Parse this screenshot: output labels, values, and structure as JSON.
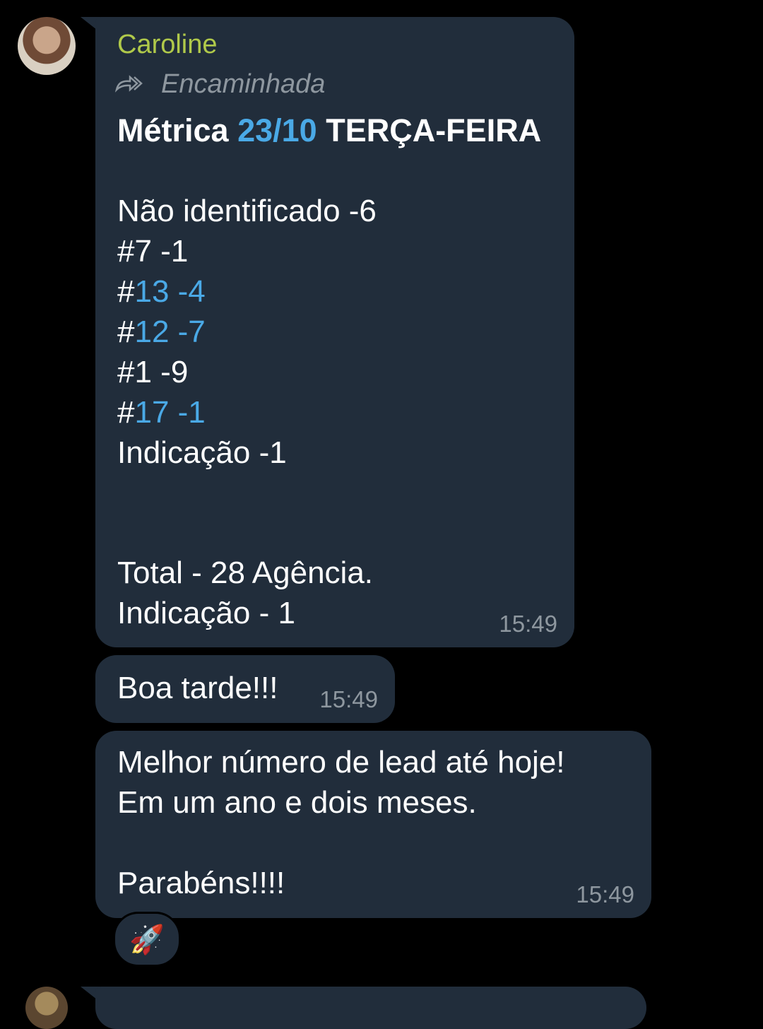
{
  "message1": {
    "sender": "Caroline",
    "forwarded_label": "Encaminhada",
    "title_prefix": "Métrica ",
    "title_date": "23/10",
    "title_suffix": " TERÇA-FEIRA",
    "lines": [
      {
        "prefix": "Não identificado -6",
        "link": ""
      },
      {
        "prefix": "#7 -1",
        "link": ""
      },
      {
        "prefix": "#",
        "link": "13 -4"
      },
      {
        "prefix": "#",
        "link": "12 -7"
      },
      {
        "prefix": "#1 -9",
        "link": ""
      },
      {
        "prefix": "#",
        "link": "17 -1"
      },
      {
        "prefix": "Indicação -1",
        "link": ""
      }
    ],
    "total_line": "Total - 28 Agência.",
    "indicacao_line": "Indicação - 1",
    "time": "15:49"
  },
  "message2": {
    "text": "Boa tarde!!!",
    "time": "15:49"
  },
  "message3": {
    "line1": "Melhor número de lead até hoje!",
    "line2": "Em um ano e dois meses.",
    "line3": "Parabéns!!!!",
    "time": "15:49",
    "reaction": "🚀"
  }
}
